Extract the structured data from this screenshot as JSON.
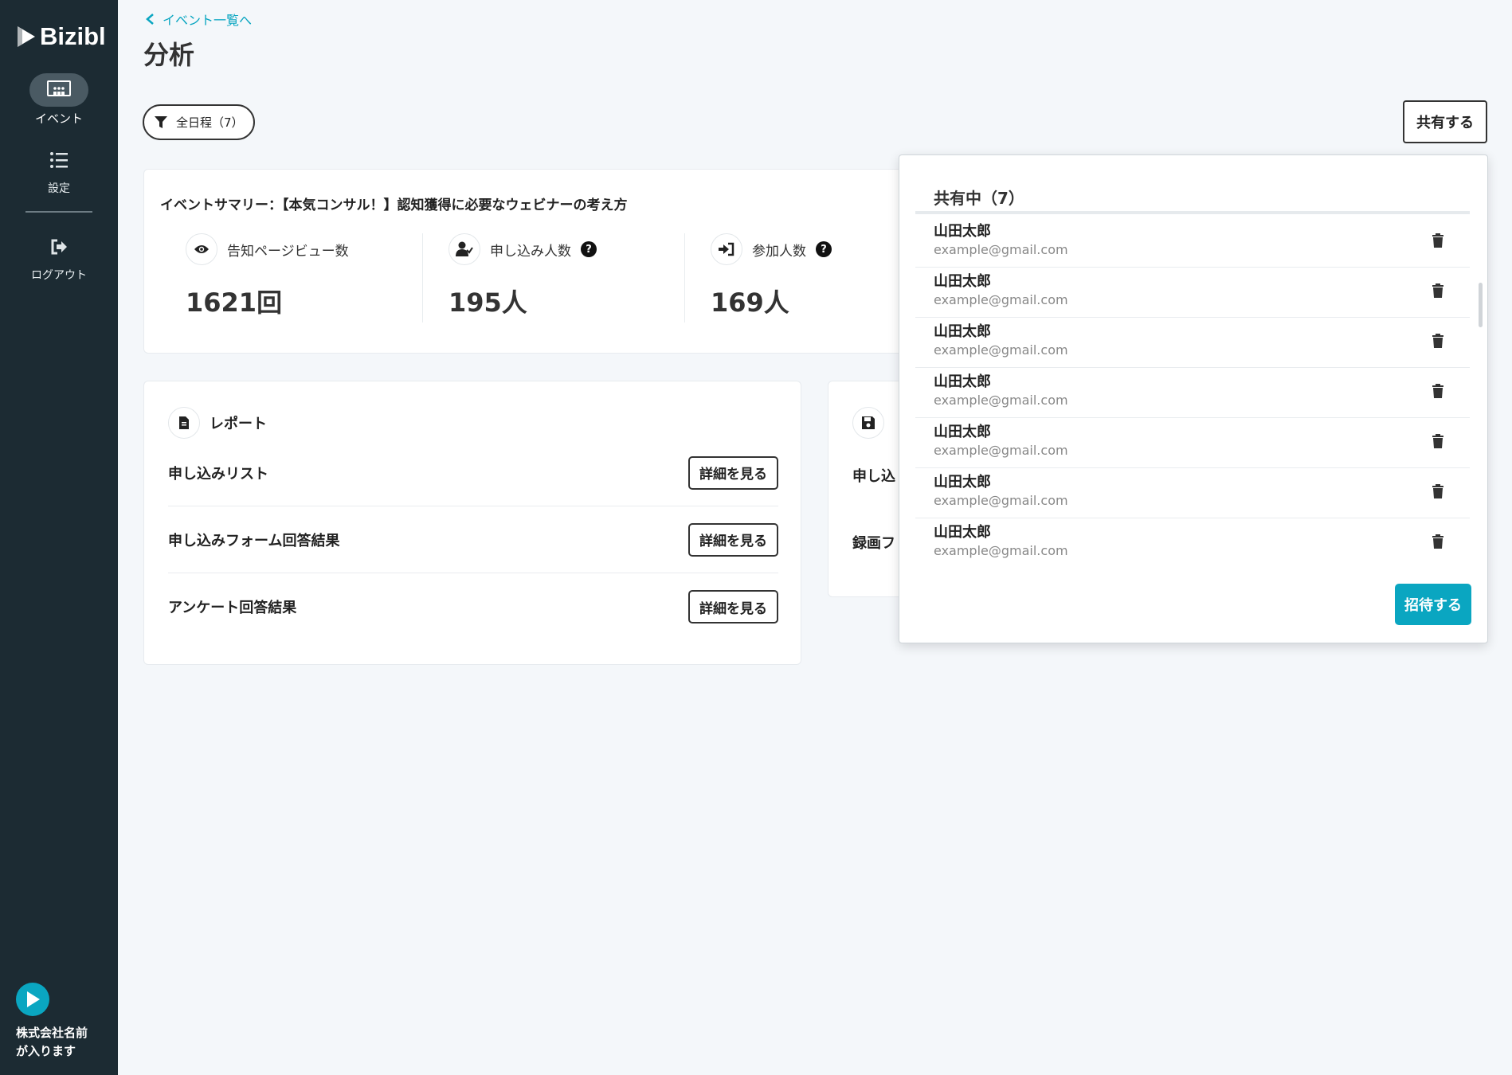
{
  "app": {
    "logo_text": "Bizibl"
  },
  "sidebar": {
    "items": [
      {
        "label": "イベント",
        "icon": "presentation-icon",
        "active": true
      },
      {
        "label": "設定",
        "icon": "list-icon",
        "active": false
      },
      {
        "label": "ログアウト",
        "icon": "logout-icon",
        "active": false
      }
    ],
    "company_name": "株式会社名前\nが入ります"
  },
  "header": {
    "back_label": "イベント一覧へ",
    "title": "分析",
    "filter_label": "全日程（7）",
    "share_label": "共有する"
  },
  "summary": {
    "title": "イベントサマリー：【本気コンサル！】認知獲得に必要なウェビナーの考え方",
    "metrics": [
      {
        "label": "告知ページビュー数",
        "value": "1621回",
        "icon": "eye-icon",
        "help": false
      },
      {
        "label": "申し込み人数",
        "value": "195人",
        "icon": "user-check-icon",
        "help": true
      },
      {
        "label": "参加人数",
        "value": "169人",
        "icon": "sign-in-icon",
        "help": true
      }
    ],
    "help_glyph": "?"
  },
  "report": {
    "title": "レポート",
    "detail_label": "詳細を見る",
    "rows": [
      {
        "label": "申し込みリスト"
      },
      {
        "label": "申し込みフォーム回答結果"
      },
      {
        "label": "アンケート回答結果"
      }
    ]
  },
  "files": {
    "title_partial": "",
    "rows": [
      {
        "label": "申し込"
      },
      {
        "label": "録画フ"
      }
    ]
  },
  "share_panel": {
    "title": "共有中（7）",
    "users": [
      {
        "name": "山田太郎",
        "email": "example@gmail.com"
      },
      {
        "name": "山田太郎",
        "email": "example@gmail.com"
      },
      {
        "name": "山田太郎",
        "email": "example@gmail.com"
      },
      {
        "name": "山田太郎",
        "email": "example@gmail.com"
      },
      {
        "name": "山田太郎",
        "email": "example@gmail.com"
      },
      {
        "name": "山田太郎",
        "email": "example@gmail.com"
      },
      {
        "name": "山田太郎",
        "email": "example@gmail.com"
      }
    ],
    "invite_label": "招待する"
  },
  "colors": {
    "accent": "#0aa6c1",
    "sidebar": "#1c2b33",
    "background": "#f4f7fa"
  }
}
